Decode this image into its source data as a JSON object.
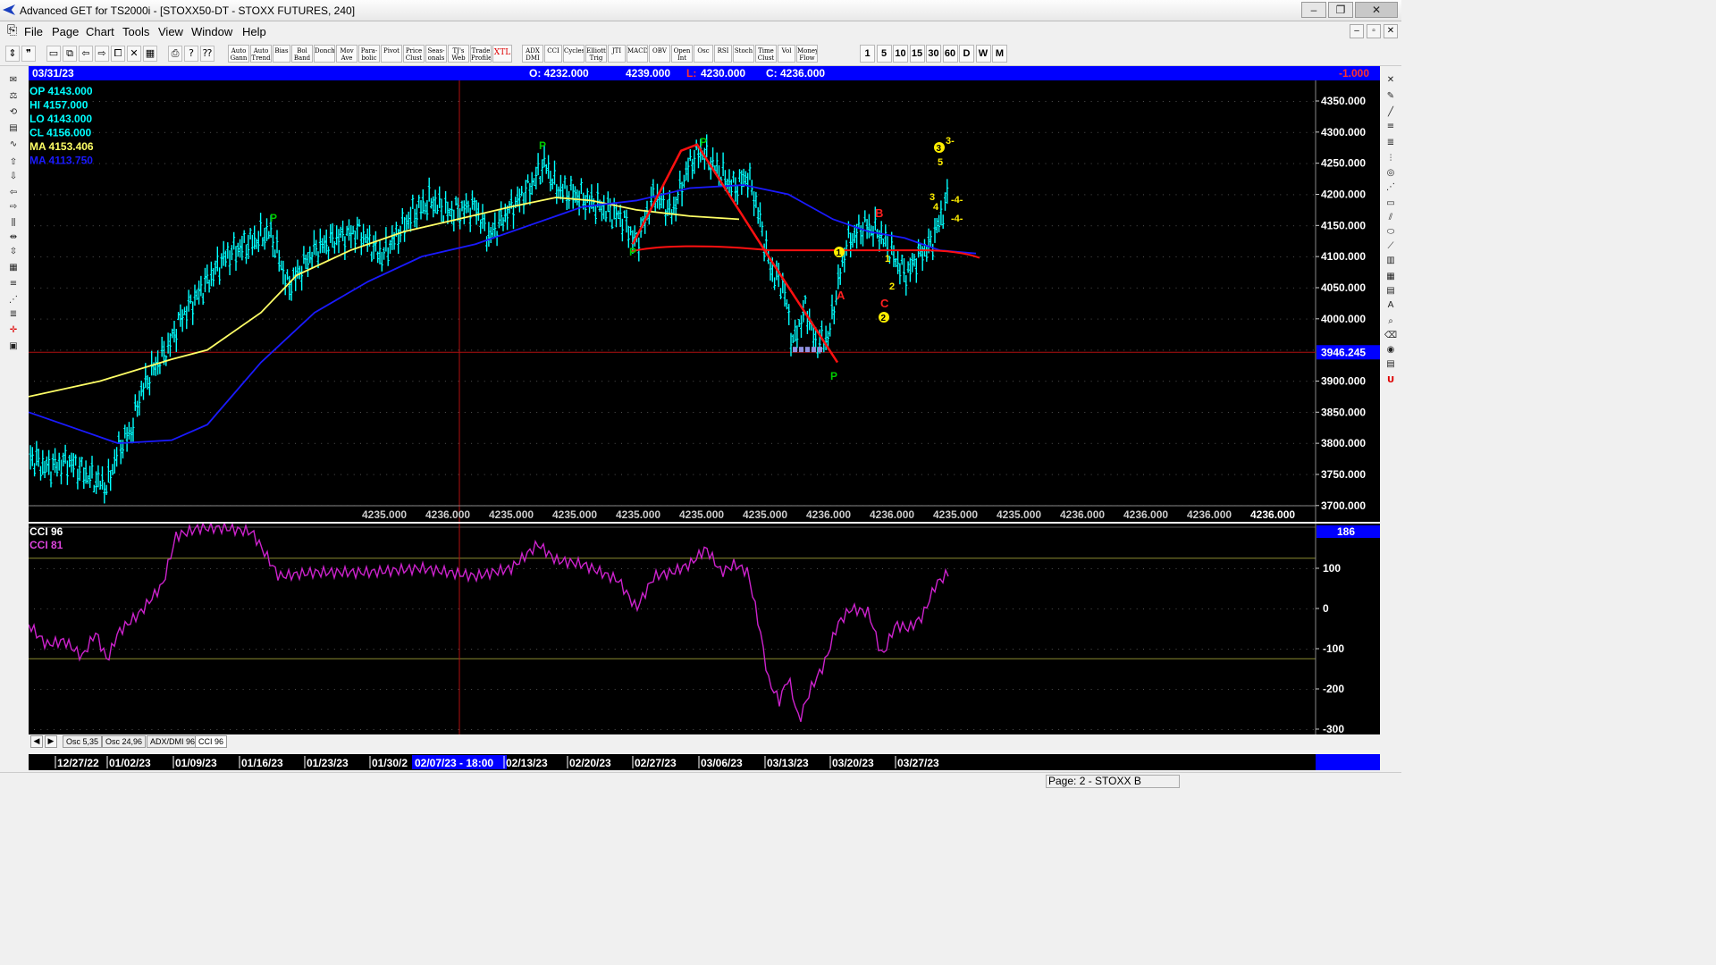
{
  "window": {
    "title": "Advanced GET for TS2000i - [STOXX50-DT - STOXX FUTURES, 240]",
    "minimize": "–",
    "maximize": "❐",
    "close": "✕"
  },
  "menu": {
    "items": [
      "File",
      "Page",
      "Chart",
      "Tools",
      "View",
      "Window",
      "Help"
    ],
    "mdi_buttons": [
      "–",
      "▫",
      "✕"
    ]
  },
  "toolbar": {
    "study_buttons": [
      "Auto\nGann",
      "Auto\nTrend",
      "Bias",
      "Bol\nBand",
      "Donch",
      "Mov\nAve",
      "Para-\nbolic",
      "Pivot",
      "Price\nClust",
      "Seas-\nonals",
      "TJ's\nWeb",
      "Trade\nProfile",
      "XTL",
      "ADX\nDMI",
      "CCI",
      "Cycles",
      "Elliott\nTrig",
      "JTI",
      "MACD",
      "OBV",
      "Open\nInt",
      "Osc",
      "RSI",
      "Stoch",
      "Time\nClust",
      "Vol",
      "Money\nFlow"
    ],
    "period_buttons": [
      "1",
      "5",
      "10",
      "15",
      "30",
      "60",
      "D",
      "W",
      "M"
    ]
  },
  "infobar": {
    "date": "03/31/23",
    "open": "O: 4232.000",
    "high": "4239.000",
    "low_label": "L:",
    "low": "4230.000",
    "close": "C: 4236.000",
    "change": "-1.000"
  },
  "legend": {
    "op": "OP  4143.000",
    "hi": "HI  4157.000",
    "lo": "LO  4143.000",
    "cl": "CL  4156.000",
    "ma1": "MA  4153.406",
    "ma2": "MA  4113.750"
  },
  "price_axis": {
    "ticks": [
      "4350.000",
      "4300.000",
      "4250.000",
      "4200.000",
      "4150.000",
      "4100.000",
      "4050.000",
      "4000.000",
      "3900.000",
      "3850.000",
      "3800.000",
      "3750.000",
      "3700.000"
    ],
    "cursor_price": "3946.245"
  },
  "bottom_values": [
    "4235.000",
    "4236.000",
    "4235.000",
    "4235.000",
    "4235.000",
    "4235.000",
    "4235.000",
    "4236.000",
    "4236.000",
    "4235.000",
    "4235.000",
    "4236.000",
    "4236.000",
    "4236.000",
    "4236.000"
  ],
  "wave_labels": {
    "pivots": [
      "P",
      "P",
      "P",
      "P",
      "P",
      "P"
    ],
    "abc": [
      "A",
      "B",
      "C"
    ],
    "elliott": [
      "1",
      "2",
      "3",
      "4",
      "5",
      "3",
      "4",
      "1",
      "2",
      "-4-",
      "-4-",
      "3-"
    ]
  },
  "cci": {
    "title": "CCI 96",
    "subtitle": "CCI  81",
    "current": "186",
    "ticks": [
      "100",
      "0",
      "-100",
      "-200",
      "-300"
    ]
  },
  "tabs": [
    "Osc 5,35",
    "Osc 24,96",
    "ADX/DMI 96",
    "CCI 96"
  ],
  "tab_nav": [
    "◀",
    "▶"
  ],
  "dates": [
    "12/27/22",
    "01/02/23",
    "01/09/23",
    "01/16/23",
    "01/23/23",
    "01/30/2",
    "02/07/23 - 18:00",
    "02/13/23",
    "02/20/23",
    "02/27/23",
    "03/06/23",
    "03/13/23",
    "03/20/23",
    "03/27/23"
  ],
  "status": {
    "page": "Page: 2 - STOXX B"
  },
  "colors": {
    "chart_bg": "#000000",
    "bars": "#00ffff",
    "ma_fast": "#ffff66",
    "ma_slow": "#1a1aff",
    "trend": "#ff1010",
    "pivot": "#00cc00",
    "elliott": "#ffee00",
    "cci": "#cc22cc",
    "info_bg": "#0000ff"
  }
}
